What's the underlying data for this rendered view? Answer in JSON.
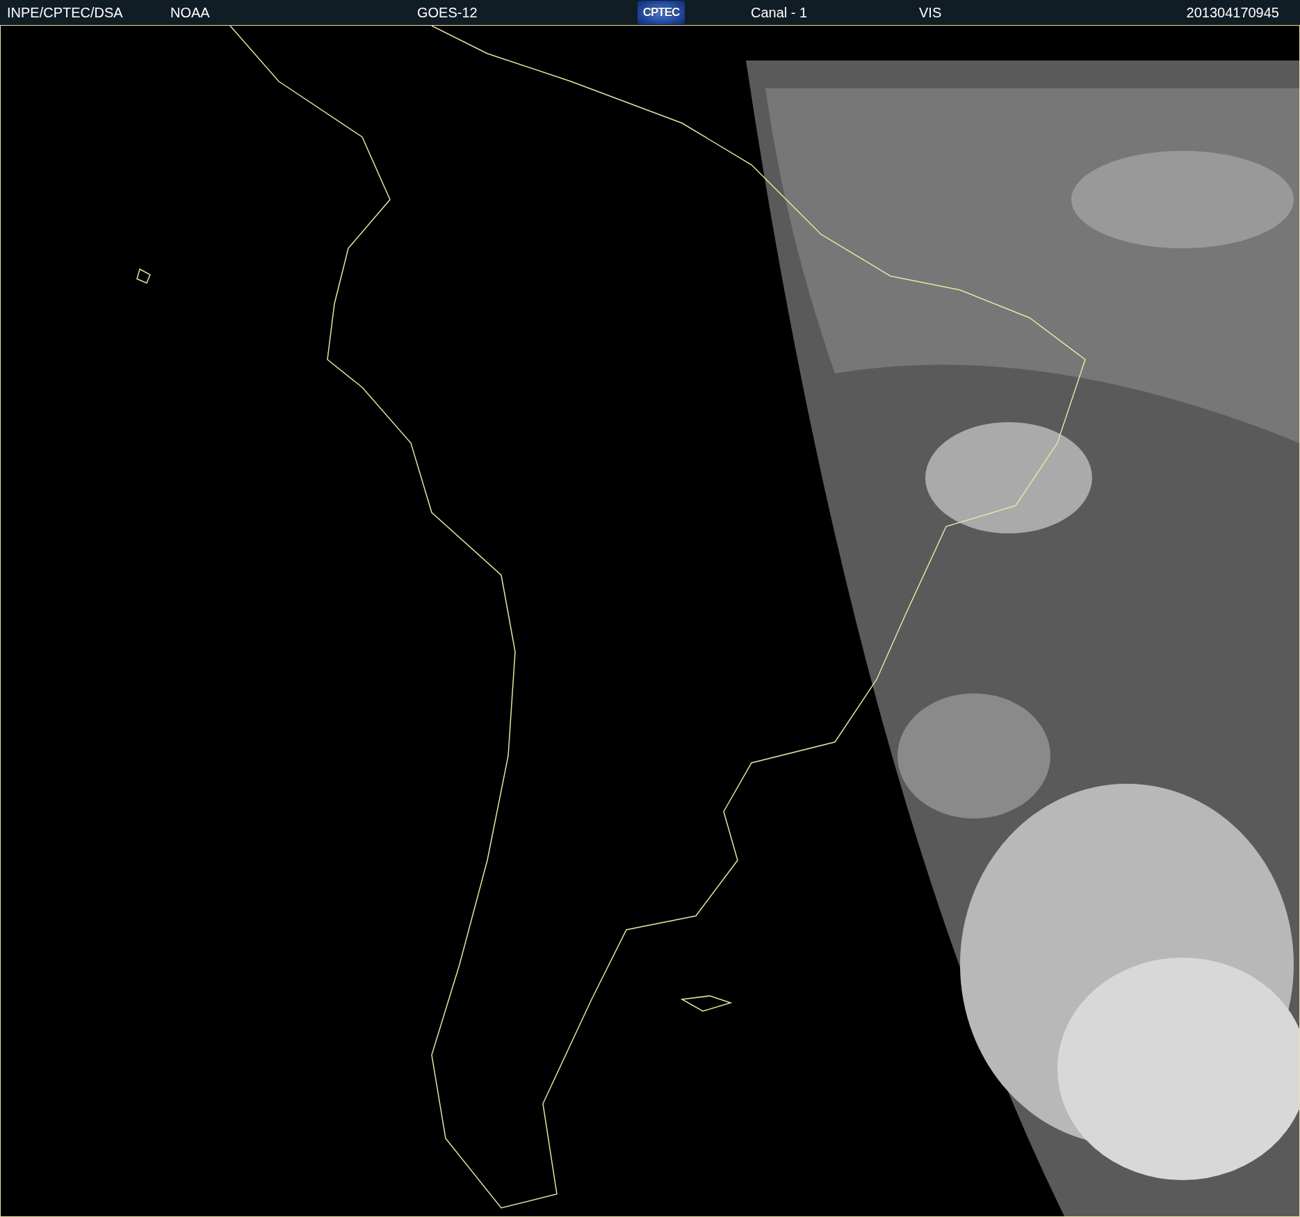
{
  "header": {
    "items": [
      {
        "kind": "text",
        "label": "INPE/CPTEC/DSA"
      },
      {
        "kind": "text",
        "label": "NOAA"
      },
      {
        "kind": "text",
        "label": "GOES-12"
      },
      {
        "kind": "logo",
        "label": "CPTEC"
      },
      {
        "kind": "text",
        "label": "Canal - 1"
      },
      {
        "kind": "text",
        "label": "VIS"
      },
      {
        "kind": "text",
        "label": "201304170945"
      }
    ]
  }
}
